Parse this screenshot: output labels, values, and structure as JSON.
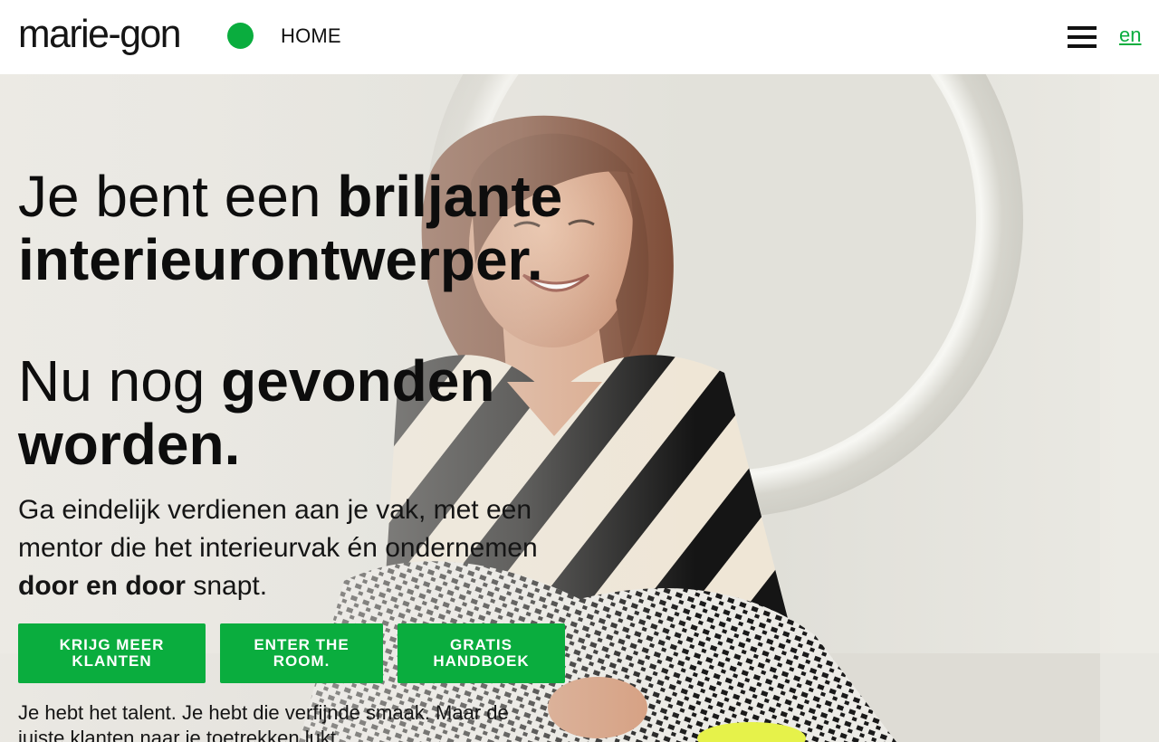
{
  "header": {
    "logo_text": "marie-gon",
    "nav_home": "HOME",
    "lang": "en"
  },
  "hero": {
    "line1_regular": "Je bent een ",
    "line1_bold": "briljante interieurontwerper.",
    "line2_regular": "Nu nog ",
    "line2_bold": "gevonden worden.",
    "intro_regular_1": "Ga eindelijk verdienen aan je vak, met een mentor die het interieurvak én ondernemen ",
    "intro_bold": "door en door",
    "intro_regular_2": " snapt.",
    "buttons": [
      {
        "label": "KRIJG MEER KLANTEN"
      },
      {
        "label": "ENTER THE ROOM."
      },
      {
        "label": "GRATIS HANDBOEK"
      }
    ],
    "subtext": "Je hebt het talent. Je hebt die verfijnde smaak. Maar de juiste klanten naar je toetrekken lukt..."
  },
  "colors": {
    "accent": "#0aad3e",
    "text": "#111111",
    "background": "#ffffff"
  },
  "icons": {
    "menu": "hamburger-icon",
    "brand_dot": "green-dot-icon"
  }
}
